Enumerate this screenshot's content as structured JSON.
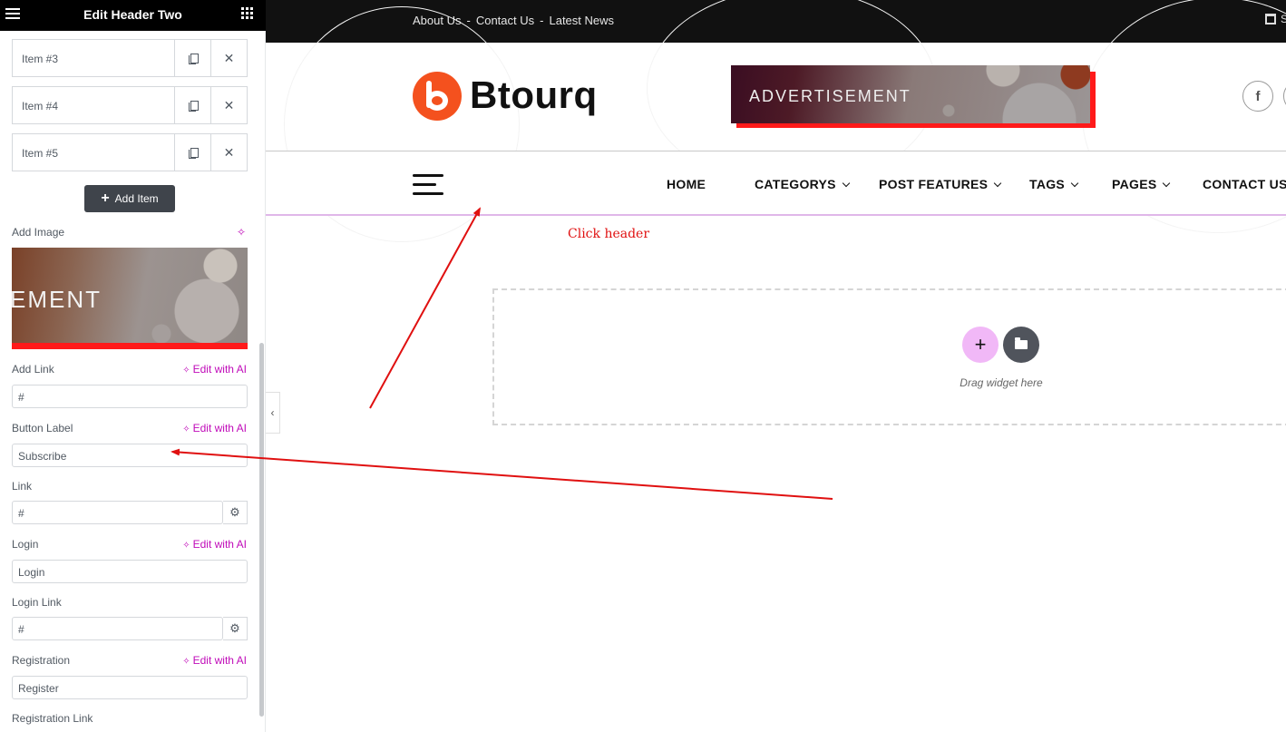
{
  "panel": {
    "title": "Edit Header Two",
    "repeater_items": [
      {
        "label": "Item #3"
      },
      {
        "label": "Item #4"
      },
      {
        "label": "Item #5"
      }
    ],
    "add_item_label": "Add Item",
    "add_image_label": "Add Image",
    "image_preview_text": "EMENT",
    "edit_ai_label": "Edit with AI",
    "fields": {
      "add_link": {
        "label": "Add Link",
        "value": "#"
      },
      "button_label": {
        "label": "Button Label",
        "value": "Subscribe"
      },
      "link": {
        "label": "Link",
        "value": "#"
      },
      "login": {
        "label": "Login",
        "value": "Login"
      },
      "login_link": {
        "label": "Login Link",
        "value": "#"
      },
      "registration": {
        "label": "Registration",
        "value": "Register"
      },
      "registration_link": {
        "label": "Registration Link"
      }
    }
  },
  "preview": {
    "topbar_links": [
      "About Us",
      "Contact Us",
      "Latest News"
    ],
    "topbar_separator": "-",
    "topbar_right_text": "S",
    "logo_text": "Btourq",
    "ad_text": "ADVERTISEMENT",
    "social_icons": [
      "f"
    ],
    "nav": {
      "home": "HOME",
      "categorys": "CATEGORYS",
      "post_features": "POST FEATURES",
      "tags": "TAGS",
      "pages": "PAGES",
      "contact_us": "CONTACT US"
    },
    "annotation": "Click header",
    "drop_zone_text": "Drag widget here"
  },
  "colors": {
    "accent_ai": "#c00bb9",
    "logo_orange": "#f4511e",
    "annotation_red": "#e01010",
    "dropzone_plus": "#f1b8f7"
  }
}
